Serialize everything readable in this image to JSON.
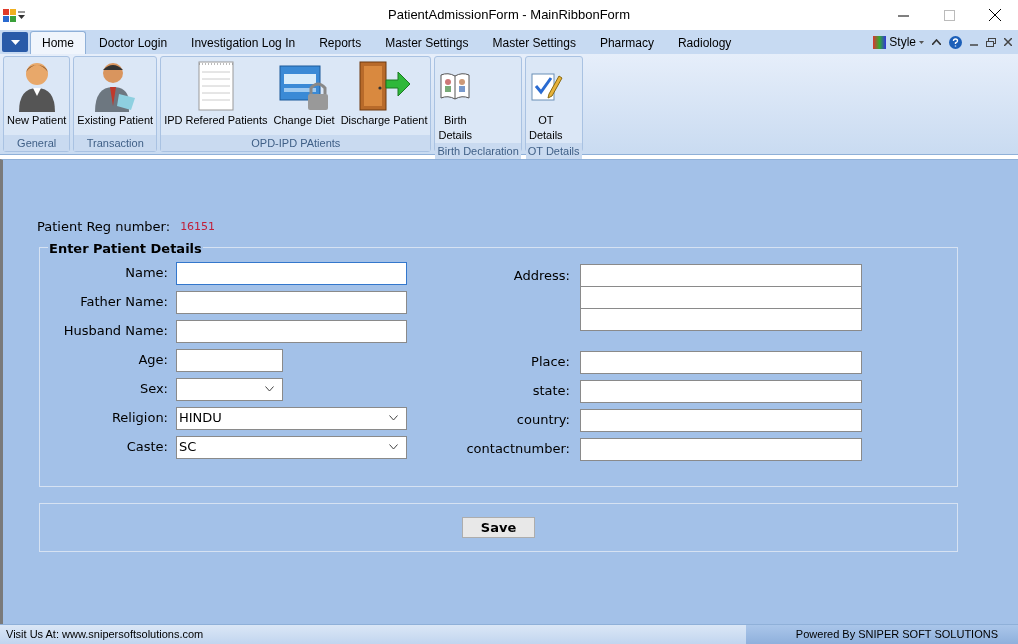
{
  "window": {
    "title": "PatientAdmissionForm - MainRibbonForm"
  },
  "tabs": [
    {
      "label": "Home",
      "selected": true
    },
    {
      "label": "Doctor Login",
      "selected": false
    },
    {
      "label": "Investigation Log In",
      "selected": false
    },
    {
      "label": "Reports",
      "selected": false
    },
    {
      "label": "Master Settings",
      "selected": false
    },
    {
      "label": "Master Settings",
      "selected": false
    },
    {
      "label": "Pharmacy",
      "selected": false
    },
    {
      "label": "Radiology",
      "selected": false
    }
  ],
  "style_menu": {
    "label": "Style"
  },
  "ribbon_groups": [
    {
      "label": "General",
      "buttons": [
        {
          "label": "New Patient"
        }
      ]
    },
    {
      "label": "Transaction",
      "buttons": [
        {
          "label": "Existing Patient"
        }
      ]
    },
    {
      "label": "OPD-IPD PAtients",
      "buttons": [
        {
          "label": "IPD Refered Patients"
        },
        {
          "label": "Change Diet"
        },
        {
          "label": "Discharge Patient"
        }
      ]
    },
    {
      "label": "Birth Declaration",
      "buttons": [
        {
          "label": "Birth\nDetails"
        }
      ]
    },
    {
      "label": "OT Details",
      "buttons": [
        {
          "label": "OT\nDetails"
        }
      ]
    }
  ],
  "reg": {
    "label": "Patient Reg number:",
    "value": "16151"
  },
  "details": {
    "title": "Enter Patient Details",
    "left_fields": [
      {
        "label": "Name:",
        "kind": "text",
        "focused": true
      },
      {
        "label": "Father Name:",
        "kind": "text",
        "focused": false
      },
      {
        "label": "Husband Name:",
        "kind": "text",
        "focused": false
      },
      {
        "label": "Age:",
        "kind": "shorttext",
        "focused": false
      },
      {
        "label": "Sex:",
        "kind": "shortdropdown",
        "focused": false
      },
      {
        "label": "Religion:",
        "kind": "dropdown",
        "value": "HINDU",
        "focused": false
      },
      {
        "label": "Caste:",
        "kind": "dropdown",
        "value": "SC",
        "focused": false
      }
    ],
    "address": {
      "label": "Address:"
    },
    "right_fields": [
      {
        "label": "Place:"
      },
      {
        "label": "state:"
      },
      {
        "label": "country:"
      },
      {
        "label": "contactnumber:"
      }
    ]
  },
  "save_button": {
    "label": "Save"
  },
  "status_bar": {
    "left": "Visit Us At: www.snipersoftsolutions.com",
    "right": "Powered By SNIPER SOFT SOLUTIONS"
  }
}
